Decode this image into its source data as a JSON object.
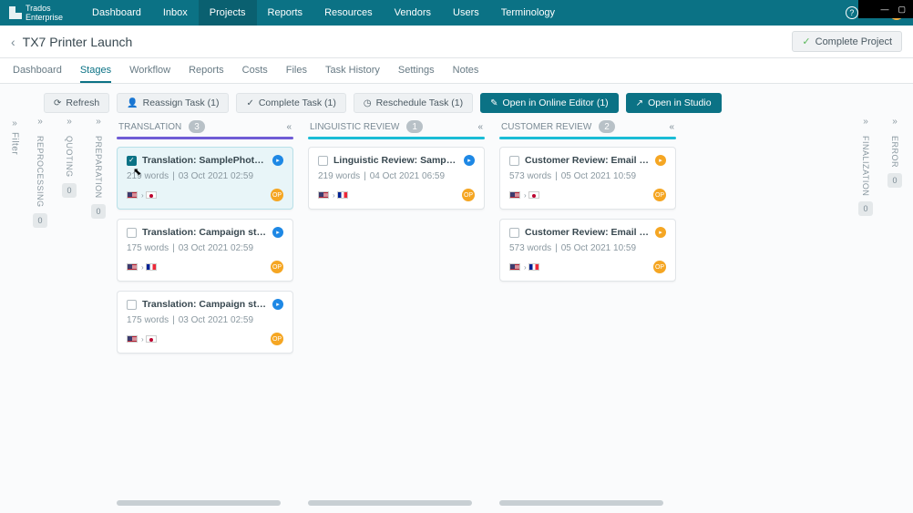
{
  "brand": {
    "line1": "Trados",
    "line2": "Enterprise"
  },
  "topnav": [
    "Dashboard",
    "Inbox",
    "Projects",
    "Reports",
    "Resources",
    "Vendors",
    "Users",
    "Terminology"
  ],
  "topnav_active": 2,
  "page_title": "TX7 Printer Launch",
  "complete_button": "Complete Project",
  "tabs": [
    "Dashboard",
    "Stages",
    "Workflow",
    "Reports",
    "Costs",
    "Files",
    "Task History",
    "Settings",
    "Notes"
  ],
  "tabs_active": 1,
  "filter_label": "Filter",
  "toolbar": {
    "refresh": "Refresh",
    "reassign": "Reassign Task (1)",
    "complete": "Complete Task (1)",
    "reschedule": "Reschedule Task (1)",
    "online": "Open in Online Editor (1)",
    "studio": "Open in Studio"
  },
  "mini_left": [
    {
      "label": "REPROCESSING",
      "badge": "0"
    },
    {
      "label": "QUOTING",
      "badge": "0"
    },
    {
      "label": "PREPARATION",
      "badge": "0"
    }
  ],
  "mini_right": [
    {
      "label": "FINALIZATION",
      "badge": "0"
    },
    {
      "label": "ERROR",
      "badge": "0"
    }
  ],
  "columns": [
    {
      "name": "TRANSLATION",
      "count": "3",
      "bar": "purple",
      "cards": [
        {
          "selected": true,
          "title": "Translation: SamplePhotoPrinter.docx",
          "words": "219 words",
          "date": "03 Oct 2021 02:59",
          "src": "us",
          "tgt": "jp",
          "status": "blue",
          "assignee": "OP"
        },
        {
          "selected": false,
          "title": "Translation: Campaign stats.xlsx",
          "words": "175 words",
          "date": "03 Oct 2021 02:59",
          "src": "us",
          "tgt": "fr",
          "status": "blue",
          "assignee": "OP"
        },
        {
          "selected": false,
          "title": "Translation: Campaign stats.xlsx",
          "words": "175 words",
          "date": "03 Oct 2021 02:59",
          "src": "us",
          "tgt": "jp",
          "status": "blue",
          "assignee": "OP"
        }
      ]
    },
    {
      "name": "LINGUISTIC REVIEW",
      "count": "1",
      "bar": "teal",
      "cards": [
        {
          "selected": false,
          "title": "Linguistic Review: SamplePhotoPrinter.docx",
          "words": "219 words",
          "date": "04 Oct 2021 06:59",
          "src": "us",
          "tgt": "fr",
          "status": "blue",
          "assignee": "OP"
        }
      ]
    },
    {
      "name": "CUSTOMER REVIEW",
      "count": "2",
      "bar": "teal",
      "cards": [
        {
          "selected": false,
          "title": "Customer Review: Email communication.html",
          "words": "573 words",
          "date": "05 Oct 2021 10:59",
          "src": "us",
          "tgt": "jp",
          "status": "orange",
          "assignee": "OP"
        },
        {
          "selected": false,
          "title": "Customer Review: Email communication.html",
          "words": "573 words",
          "date": "05 Oct 2021 10:59",
          "src": "us",
          "tgt": "fr",
          "status": "orange",
          "assignee": "OP"
        }
      ]
    }
  ]
}
